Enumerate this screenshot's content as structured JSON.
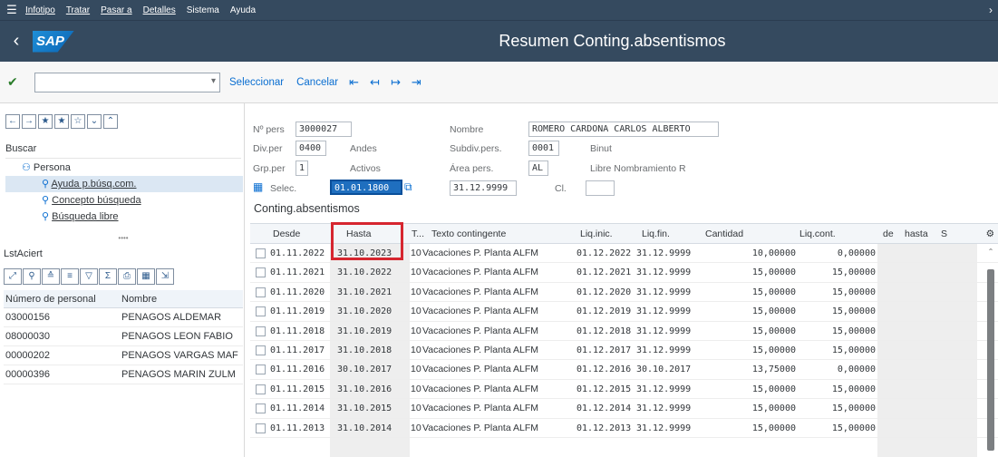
{
  "menu": {
    "items": [
      "Infotipo",
      "Tratar",
      "Pasar a",
      "Detalles",
      "Sistema",
      "Ayuda"
    ]
  },
  "titlebar": {
    "logo": "SAP",
    "title": "Resumen Conting.absentismos"
  },
  "toolbar": {
    "command_value": "",
    "select_label": "Seleccionar",
    "cancel_label": "Cancelar"
  },
  "left": {
    "buscar_label": "Buscar",
    "tree": {
      "root": "Persona",
      "items": [
        "Ayuda p.búsq.com.",
        "Concepto búsqueda",
        "Búsqueda libre"
      ]
    },
    "hitlist_title": "LstAciert",
    "hitlist_headers": [
      "Número de personal",
      "Nombre"
    ],
    "hitlist_rows": [
      [
        "03000156",
        "PENAGOS ALDEMAR"
      ],
      [
        "08000030",
        "PENAGOS LEON FABIO"
      ],
      [
        "00000202",
        "PENAGOS VARGAS MAF"
      ],
      [
        "00000396",
        "PENAGOS MARIN ZULM"
      ]
    ]
  },
  "header": {
    "npers_label": "Nº pers",
    "npers_value": "3000027",
    "nombre_label": "Nombre",
    "nombre_value": "ROMERO CARDONA CARLOS ALBERTO",
    "divper_label": "Div.per",
    "divper_value": "0400",
    "divper_text": "Andes",
    "subdiv_label": "Subdiv.pers.",
    "subdiv_value": "0001",
    "subdiv_text": "Binut",
    "grpper_label": "Grp.per",
    "grpper_value": "1",
    "grpper_text": "Activos",
    "area_label": "Área pers.",
    "area_value": "AL",
    "area_text": "Libre Nombramiento R",
    "selec_label": "Selec.",
    "selec_from": "01.01.1800",
    "selec_to": "31.12.9999",
    "cl_label": "Cl.",
    "cl_value": ""
  },
  "section_title": "Conting.absentismos",
  "table": {
    "headers": [
      "Desde",
      "Hasta",
      "T...",
      "Texto contingente",
      "Liq.inic.",
      "Liq.fin.",
      "Cantidad",
      "Liq.cont.",
      "de",
      "hasta",
      "S"
    ],
    "rows": [
      [
        "01.11.2022",
        "31.10.2023",
        "10",
        "Vacaciones P. Planta ALFM",
        "01.12.2022",
        "31.12.9999",
        "10,00000",
        "0,00000"
      ],
      [
        "01.11.2021",
        "31.10.2022",
        "10",
        "Vacaciones P. Planta ALFM",
        "01.12.2021",
        "31.12.9999",
        "15,00000",
        "15,00000"
      ],
      [
        "01.11.2020",
        "31.10.2021",
        "10",
        "Vacaciones P. Planta ALFM",
        "01.12.2020",
        "31.12.9999",
        "15,00000",
        "15,00000"
      ],
      [
        "01.11.2019",
        "31.10.2020",
        "10",
        "Vacaciones P. Planta ALFM",
        "01.12.2019",
        "31.12.9999",
        "15,00000",
        "15,00000"
      ],
      [
        "01.11.2018",
        "31.10.2019",
        "10",
        "Vacaciones P. Planta ALFM",
        "01.12.2018",
        "31.12.9999",
        "15,00000",
        "15,00000"
      ],
      [
        "01.11.2017",
        "31.10.2018",
        "10",
        "Vacaciones P. Planta ALFM",
        "01.12.2017",
        "31.12.9999",
        "15,00000",
        "15,00000"
      ],
      [
        "01.11.2016",
        "30.10.2017",
        "10",
        "Vacaciones P. Planta ALFM",
        "01.12.2016",
        "30.10.2017",
        "13,75000",
        "0,00000"
      ],
      [
        "01.11.2015",
        "31.10.2016",
        "10",
        "Vacaciones P. Planta ALFM",
        "01.12.2015",
        "31.12.9999",
        "15,00000",
        "15,00000"
      ],
      [
        "01.11.2014",
        "31.10.2015",
        "10",
        "Vacaciones P. Planta ALFM",
        "01.12.2014",
        "31.12.9999",
        "15,00000",
        "15,00000"
      ],
      [
        "01.11.2013",
        "31.10.2014",
        "10",
        "Vacaciones P. Planta ALFM",
        "01.12.2013",
        "31.12.9999",
        "15,00000",
        "15,00000"
      ]
    ]
  },
  "colors": {
    "shell": "#354a5f",
    "link": "#0a6ed1",
    "highlight": "#d6262f"
  }
}
